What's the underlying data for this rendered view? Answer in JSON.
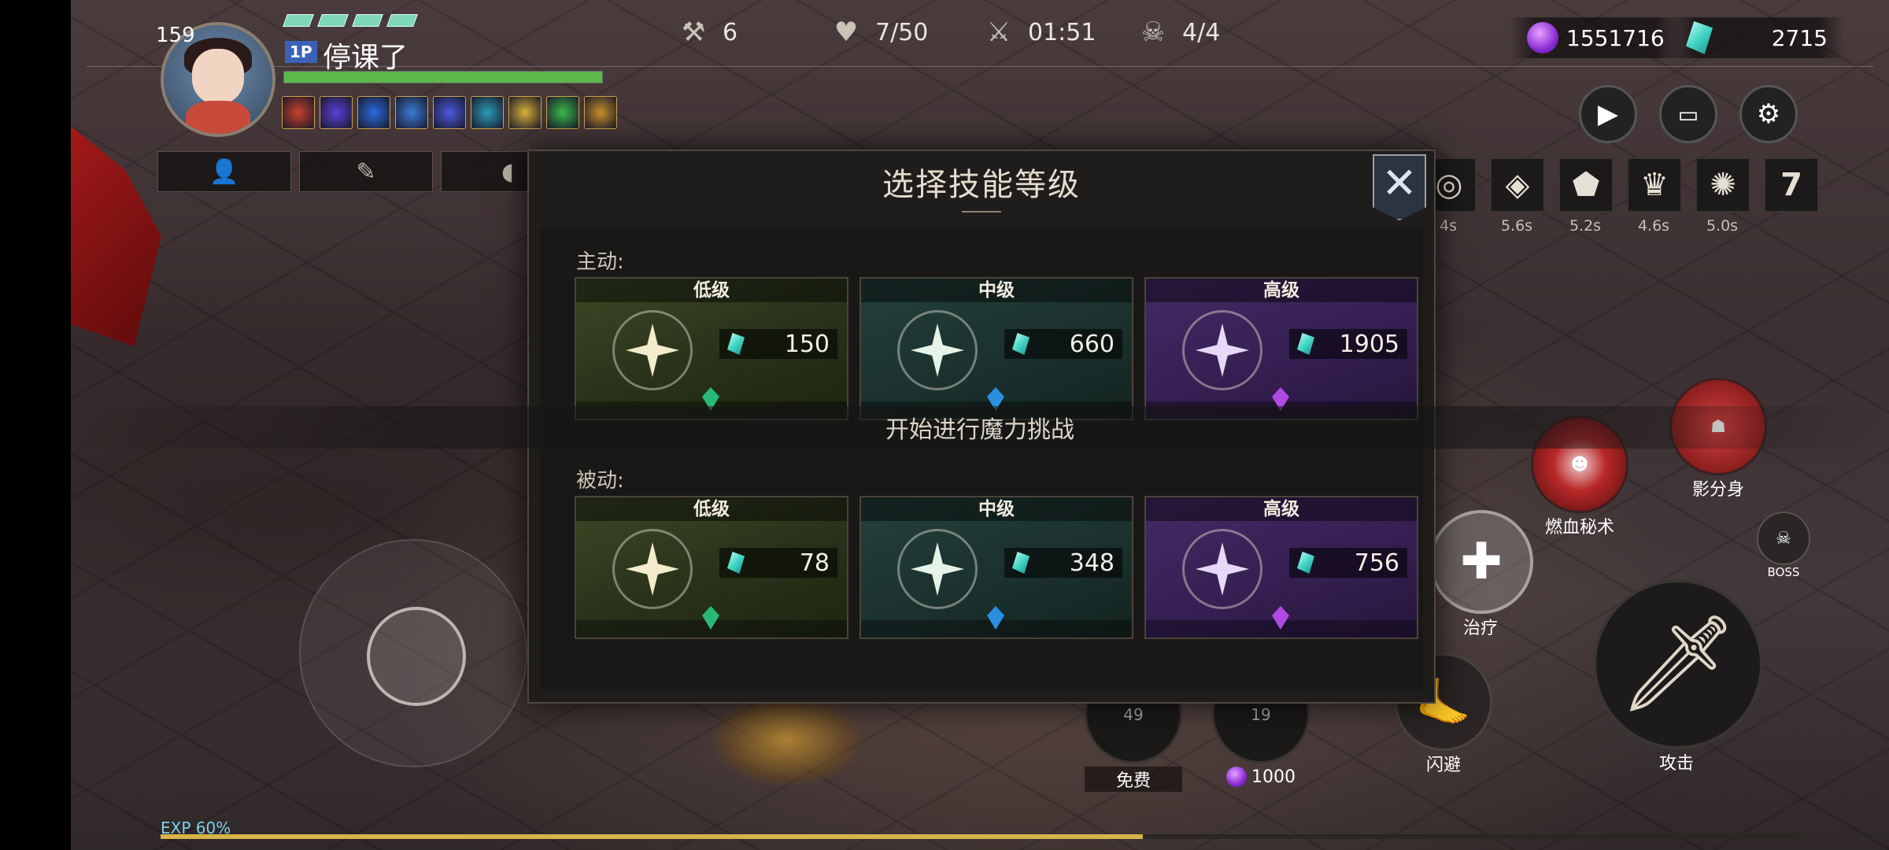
{
  "hud": {
    "level": "159",
    "player_tag": "1P",
    "player_name": "停课了",
    "hp_percent": 1.0,
    "stats": [
      {
        "icon": "wrench-icon",
        "value": "6"
      },
      {
        "icon": "heart-pulse-icon",
        "value": "7/50"
      },
      {
        "icon": "crossed-swords-icon",
        "value": "01:51"
      },
      {
        "icon": "demon-mask-icon",
        "value": "4/4"
      }
    ],
    "currency_purple": "1551716",
    "currency_cyan": "2715"
  },
  "buff_colors": [
    "#c8402a",
    "#5a3fd8",
    "#2a6ae0",
    "#3a7ad8",
    "#4a5ae0",
    "#2a9ab8",
    "#d8b03a",
    "#3ab84a",
    "#c8902a"
  ],
  "skill_cooldowns": [
    {
      "icon": "swirl-icon",
      "cd": "4s"
    },
    {
      "icon": "diamond-shield-icon",
      "cd": "5.6s"
    },
    {
      "icon": "pentagon-icon",
      "cd": "5.2s"
    },
    {
      "icon": "crown-icon",
      "cd": "4.6s"
    },
    {
      "icon": "gear-burst-icon",
      "cd": "5.0s"
    },
    {
      "icon": "number-seven-icon",
      "label": "7"
    }
  ],
  "announcement": "开始进行魔力挑战",
  "modal": {
    "title": "选择技能等级",
    "active_label": "主动:",
    "passive_label": "被动:",
    "active": [
      {
        "tier": "低级",
        "price": "150"
      },
      {
        "tier": "中级",
        "price": "660"
      },
      {
        "tier": "高级",
        "price": "1905"
      }
    ],
    "passive": [
      {
        "tier": "低级",
        "price": "78"
      },
      {
        "tier": "中级",
        "price": "348"
      },
      {
        "tier": "高级",
        "price": "756"
      }
    ]
  },
  "actions": {
    "shadow_clone": "影分身",
    "blood_burn": "燃血秘术",
    "heal": "治疗",
    "dodge": "闪避",
    "attack": "攻击",
    "boss": "BOSS",
    "free_label": "免费",
    "free_count": "49",
    "paid_count": "19",
    "paid_cost": "1000"
  },
  "exp": {
    "label": "EXP 60%",
    "percent": 0.6
  }
}
